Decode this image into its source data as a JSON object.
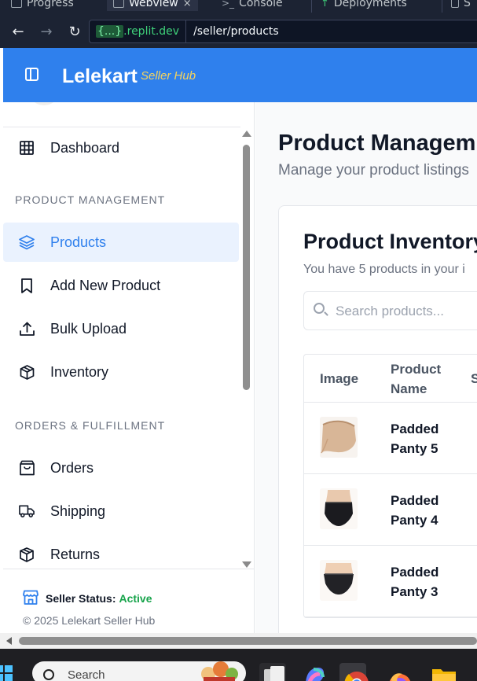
{
  "browser": {
    "tabs": [
      {
        "label": "Progress",
        "active": false
      },
      {
        "label": "Webview",
        "active": true
      },
      {
        "label": "Console",
        "active": false
      },
      {
        "label": "Deployments",
        "active": false
      },
      {
        "label": "S",
        "active": false
      }
    ],
    "tab_close": "×",
    "url_brace": "{...}",
    "url_host": ".replit.dev",
    "url_path": "/seller/products"
  },
  "header": {
    "brand": "Lelekart",
    "brand_sub": "Seller Hub"
  },
  "sidebar": {
    "items": [
      {
        "label": "Dashboard",
        "icon": "grid-icon",
        "active": false
      },
      {
        "label": "Products",
        "icon": "layers-icon",
        "active": true
      },
      {
        "label": "Add New Product",
        "icon": "bookmark-icon",
        "active": false
      },
      {
        "label": "Bulk Upload",
        "icon": "upload-icon",
        "active": false
      },
      {
        "label": "Inventory",
        "icon": "package-icon",
        "active": false
      },
      {
        "label": "Orders",
        "icon": "shopping-bag-icon",
        "active": false
      },
      {
        "label": "Shipping",
        "icon": "truck-icon",
        "active": false
      },
      {
        "label": "Returns",
        "icon": "box-return-icon",
        "active": false
      }
    ],
    "sections": [
      "PRODUCT MANAGEMENT",
      "ORDERS & FULFILLMENT"
    ],
    "status_label": "Seller Status:",
    "status_value": "Active",
    "copyright": "© 2025 Lelekart Seller Hub"
  },
  "main": {
    "title": "Product Managem",
    "subtitle": "Manage your product listings",
    "card_title": "Product Inventory",
    "card_sub": "You have 5 products in your i",
    "search_placeholder": "Search products...",
    "columns": [
      "Image",
      "Product Name",
      "S"
    ],
    "rows": [
      {
        "name": "Padded Panty 5",
        "swatch": "beige"
      },
      {
        "name": "Padded Panty 4",
        "swatch": "black"
      },
      {
        "name": "Padded Panty 3",
        "swatch": "black"
      }
    ]
  },
  "taskbar": {
    "search_label": "Search"
  },
  "colors": {
    "accent": "#2f80ed",
    "brand_sub": "#f4d35e",
    "active_status": "#16a34a"
  }
}
